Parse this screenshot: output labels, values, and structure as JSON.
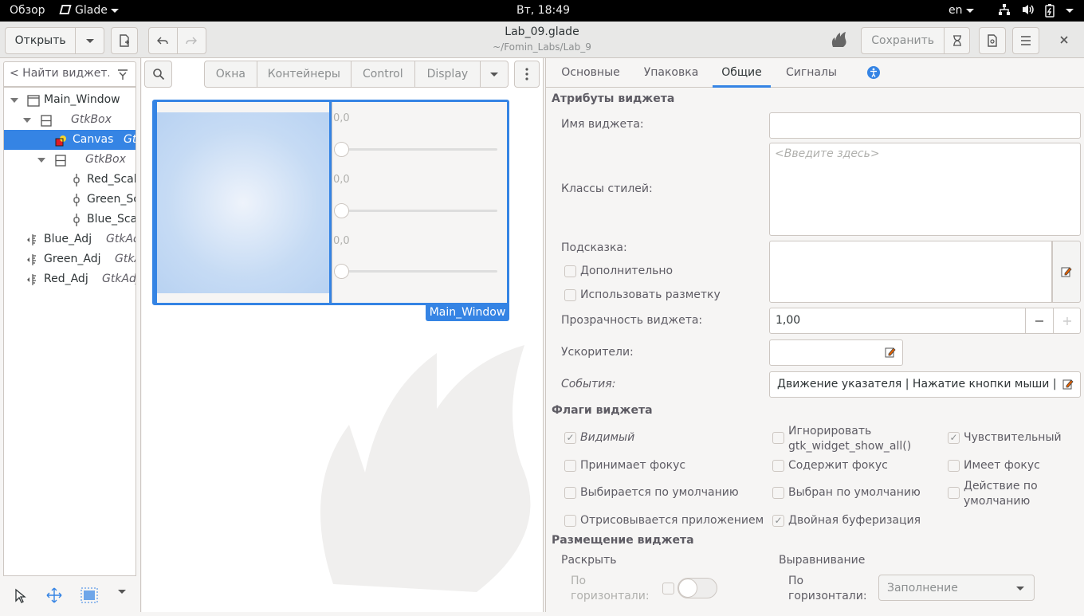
{
  "topbar": {
    "overview": "Обзор",
    "app": "Glade",
    "clock": "Вт, 18:49",
    "lang": "en"
  },
  "header": {
    "open_label": "Открыть",
    "filename": "Lab_09.glade",
    "path": "~/Fomin_Labs/Lab_9",
    "save_label": "Сохранить"
  },
  "search": {
    "placeholder": "< Найти виджет..."
  },
  "tree": {
    "items": [
      {
        "name": "Main_Window",
        "type": ""
      },
      {
        "name": "",
        "type": "GtkBox"
      },
      {
        "name": "Canvas",
        "type": "Gt"
      },
      {
        "name": "",
        "type": "GtkBox"
      },
      {
        "name": "Red_Scal",
        "type": ""
      },
      {
        "name": "Green_Sc",
        "type": ""
      },
      {
        "name": "Blue_Sca",
        "type": ""
      },
      {
        "name": "Blue_Adj",
        "type": "GtkAd"
      },
      {
        "name": "Green_Adj",
        "type": "GtkA"
      },
      {
        "name": "Red_Adj",
        "type": "GtkAdj"
      }
    ]
  },
  "palette": {
    "tabs": [
      "Окна",
      "Контейнеры",
      "Control",
      "Display"
    ]
  },
  "canvas": {
    "scale_values": [
      "0,0",
      "0,0",
      "0,0"
    ],
    "window_label": "Main_Window"
  },
  "props": {
    "tabs": [
      "Основные",
      "Упаковка",
      "Общие",
      "Сигналы"
    ],
    "active_tab": "Общие",
    "section_attrs": "Атрибуты виджета",
    "widget_name_label": "Имя виджета:",
    "style_classes_label": "Классы стилей:",
    "style_classes_placeholder": "<Введите здесь>",
    "tooltip_label": "Подсказка:",
    "extra_label": "Дополнительно",
    "use_markup_label": "Использовать разметку",
    "opacity_label": "Прозрачность виджета:",
    "opacity_value": "1,00",
    "accel_label": "Ускорители:",
    "events_label": "События:",
    "events_value": "Движение указателя | Нажатие кнопки мыши | Отпу",
    "section_flags": "Флаги виджета",
    "flags": {
      "visible": "Видимый",
      "ignore_show_all": "Игнорировать gtk_widget_show_all()",
      "sensitive": "Чувствительный",
      "can_focus": "Принимает фокус",
      "has_focus": "Содержит фокус",
      "is_focus": "Имеет фокус",
      "can_default": "Выбирается по умолчанию",
      "has_default": "Выбран по умолчанию",
      "receives_default": "Действие по умолчанию",
      "app_paintable": "Отрисовывается приложением",
      "double_buffered": "Двойная буферизация"
    },
    "section_placement": "Размещение виджета",
    "expand_label": "Раскрыть",
    "align_label": "Выравнивание",
    "horiz_label": "По горизонтали:",
    "align_value": "Заполнение"
  }
}
